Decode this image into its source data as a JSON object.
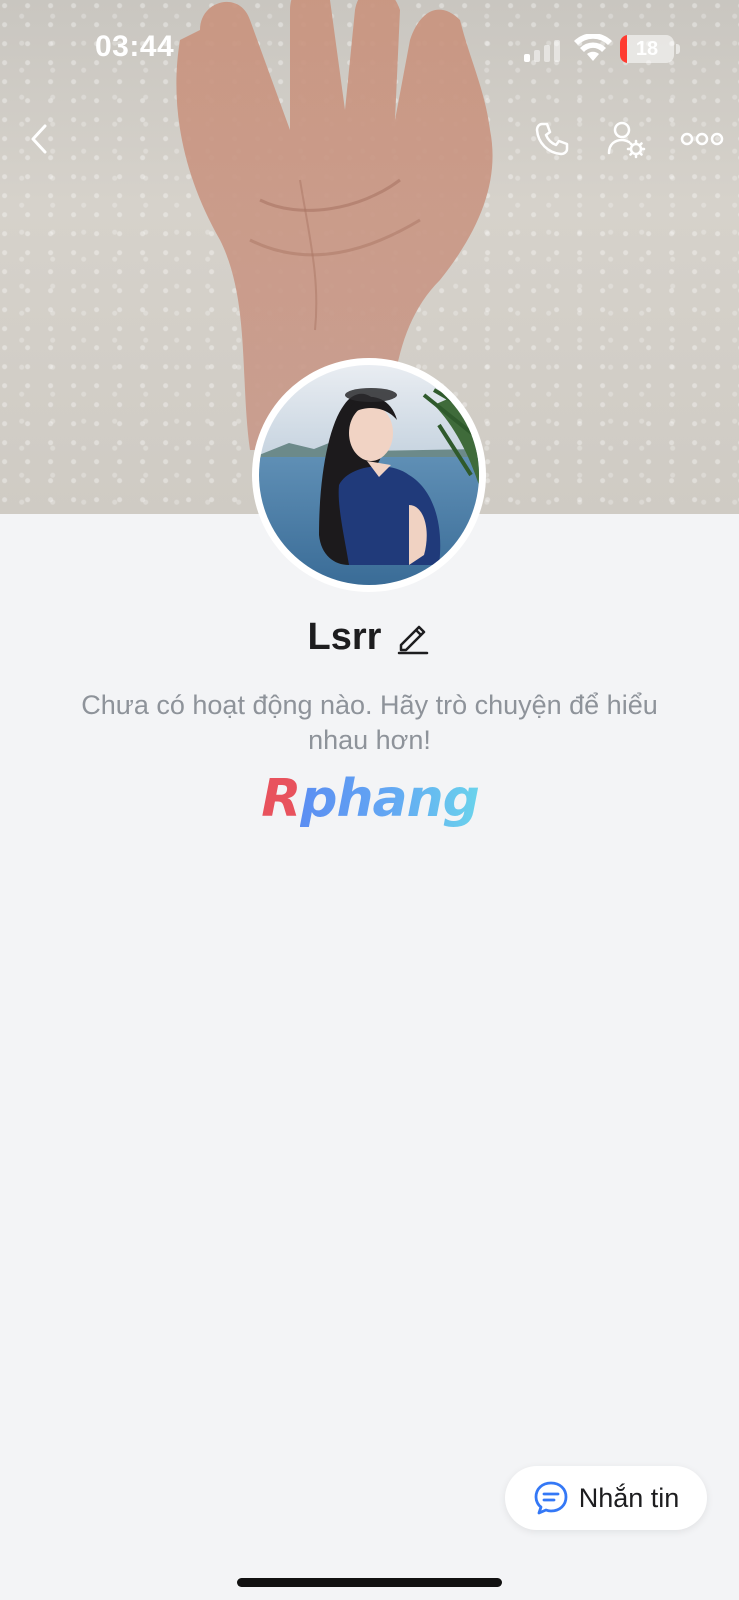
{
  "status_bar": {
    "time": "03:44",
    "battery_level": "18",
    "signal_icon": "cellular-signal-icon",
    "wifi_icon": "wifi-icon",
    "battery_icon": "battery-icon"
  },
  "nav": {
    "back_icon": "chevron-left-icon",
    "call_icon": "phone-icon",
    "settings_icon": "user-settings-icon",
    "more_icon": "more-horizontal-icon"
  },
  "profile": {
    "name": "Lsrr",
    "edit_icon": "pencil-icon",
    "empty_message": "Chưa có hoạt động nào. Hãy trò chuyện để hiểu nhau hơn!"
  },
  "watermark": {
    "first": "R",
    "rest": "phang"
  },
  "message_button": {
    "label": "Nhắn tin",
    "icon": "chat-bubble-icon"
  },
  "colors": {
    "accent": "#3478f6",
    "background": "#f3f4f6",
    "text_primary": "#1d1d1f",
    "text_secondary": "#8e939a"
  }
}
